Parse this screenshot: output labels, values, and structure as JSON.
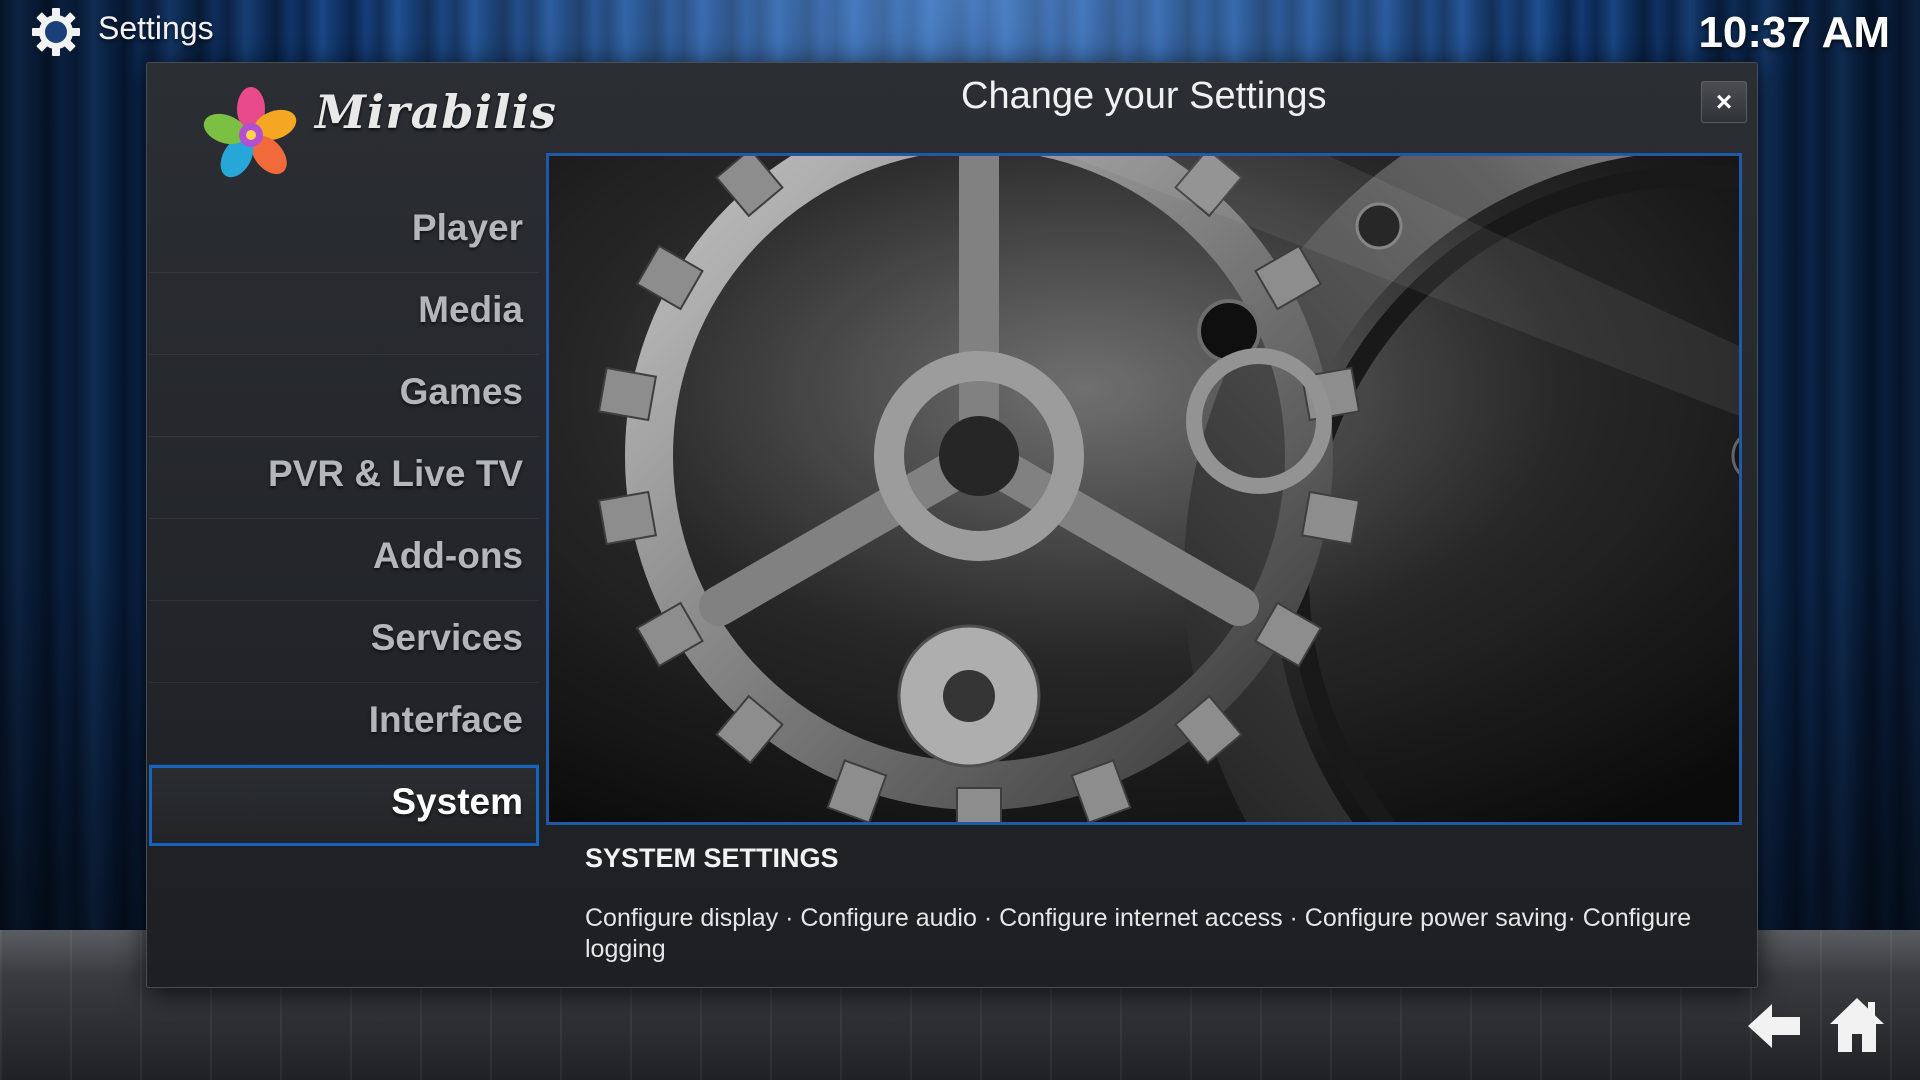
{
  "topbar": {
    "title": "Settings",
    "clock": "10:37 AM"
  },
  "dialog": {
    "title": "Change your Settings",
    "close_label": "×",
    "logo_text": "Mirabilis"
  },
  "menu": {
    "items": [
      {
        "label": "Player"
      },
      {
        "label": "Media"
      },
      {
        "label": "Games"
      },
      {
        "label": "PVR & Live TV"
      },
      {
        "label": "Add-ons"
      },
      {
        "label": "Services"
      },
      {
        "label": "Interface"
      },
      {
        "label": "System"
      }
    ],
    "selected_label": "System"
  },
  "description": {
    "title": "SYSTEM SETTINGS",
    "text": "Configure display · Configure audio · Configure internet access · Configure power saving· Configure logging"
  },
  "icons": {
    "top": "gear-icon",
    "back": "back-arrow-icon",
    "home": "home-icon"
  },
  "colors": {
    "selection_border": "#1565c0",
    "background_blue": "#1b4a8a"
  }
}
